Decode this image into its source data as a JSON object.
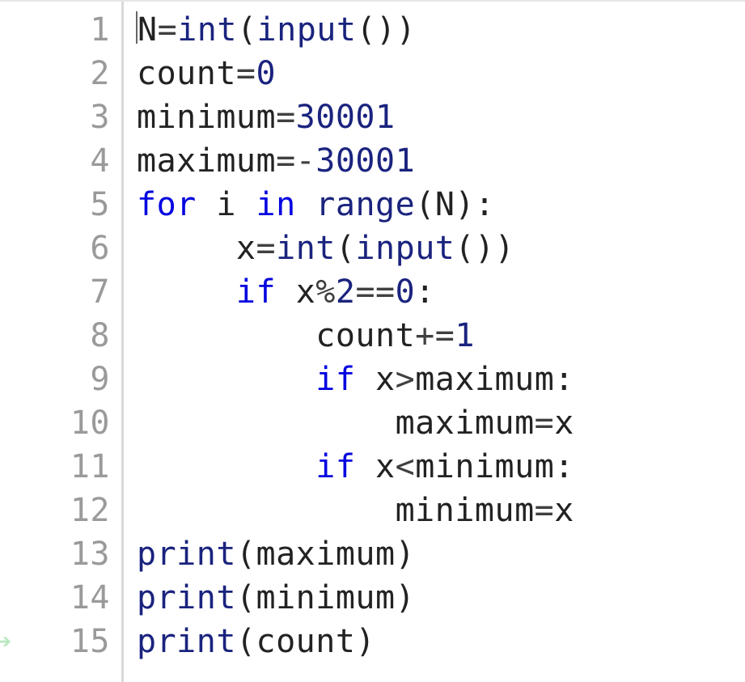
{
  "editor": {
    "cursor_line": 1,
    "cursor_col": 0,
    "active_line_arrow": 15,
    "lines": [
      {
        "n": 1,
        "tokens": [
          {
            "t": "N",
            "c": "id"
          },
          {
            "t": "=",
            "c": "op"
          },
          {
            "t": "int",
            "c": "fn"
          },
          {
            "t": "(",
            "c": "punc"
          },
          {
            "t": "input",
            "c": "fn"
          },
          {
            "t": "(",
            "c": "punc"
          },
          {
            "t": ")",
            "c": "punc"
          },
          {
            "t": ")",
            "c": "punc"
          }
        ]
      },
      {
        "n": 2,
        "tokens": [
          {
            "t": "count",
            "c": "id"
          },
          {
            "t": "=",
            "c": "op"
          },
          {
            "t": "0",
            "c": "num"
          }
        ]
      },
      {
        "n": 3,
        "tokens": [
          {
            "t": "minimum",
            "c": "id"
          },
          {
            "t": "=",
            "c": "op"
          },
          {
            "t": "30001",
            "c": "num"
          }
        ]
      },
      {
        "n": 4,
        "tokens": [
          {
            "t": "maximum",
            "c": "id"
          },
          {
            "t": "=",
            "c": "op"
          },
          {
            "t": "-",
            "c": "op"
          },
          {
            "t": "30001",
            "c": "num"
          }
        ]
      },
      {
        "n": 5,
        "tokens": [
          {
            "t": "for",
            "c": "kw"
          },
          {
            "t": " ",
            "c": "id"
          },
          {
            "t": "i",
            "c": "id"
          },
          {
            "t": " ",
            "c": "id"
          },
          {
            "t": "in",
            "c": "kw"
          },
          {
            "t": " ",
            "c": "id"
          },
          {
            "t": "range",
            "c": "fn"
          },
          {
            "t": "(",
            "c": "punc"
          },
          {
            "t": "N",
            "c": "id"
          },
          {
            "t": ")",
            "c": "punc"
          },
          {
            "t": ":",
            "c": "punc"
          }
        ]
      },
      {
        "n": 6,
        "tokens": [
          {
            "t": "     ",
            "c": "id"
          },
          {
            "t": "x",
            "c": "id"
          },
          {
            "t": "=",
            "c": "op"
          },
          {
            "t": "int",
            "c": "fn"
          },
          {
            "t": "(",
            "c": "punc"
          },
          {
            "t": "input",
            "c": "fn"
          },
          {
            "t": "(",
            "c": "punc"
          },
          {
            "t": ")",
            "c": "punc"
          },
          {
            "t": ")",
            "c": "punc"
          }
        ]
      },
      {
        "n": 7,
        "tokens": [
          {
            "t": "     ",
            "c": "id"
          },
          {
            "t": "if",
            "c": "kw"
          },
          {
            "t": " ",
            "c": "id"
          },
          {
            "t": "x",
            "c": "id"
          },
          {
            "t": "%",
            "c": "op"
          },
          {
            "t": "2",
            "c": "num"
          },
          {
            "t": "==",
            "c": "op"
          },
          {
            "t": "0",
            "c": "num"
          },
          {
            "t": ":",
            "c": "punc"
          }
        ]
      },
      {
        "n": 8,
        "tokens": [
          {
            "t": "         ",
            "c": "id"
          },
          {
            "t": "count",
            "c": "id"
          },
          {
            "t": "+=",
            "c": "op"
          },
          {
            "t": "1",
            "c": "num"
          }
        ]
      },
      {
        "n": 9,
        "tokens": [
          {
            "t": "         ",
            "c": "id"
          },
          {
            "t": "if",
            "c": "kw"
          },
          {
            "t": " ",
            "c": "id"
          },
          {
            "t": "x",
            "c": "id"
          },
          {
            "t": ">",
            "c": "op"
          },
          {
            "t": "maximum",
            "c": "id"
          },
          {
            "t": ":",
            "c": "punc"
          }
        ]
      },
      {
        "n": 10,
        "tokens": [
          {
            "t": "             ",
            "c": "id"
          },
          {
            "t": "maximum",
            "c": "id"
          },
          {
            "t": "=",
            "c": "op"
          },
          {
            "t": "x",
            "c": "id"
          }
        ]
      },
      {
        "n": 11,
        "tokens": [
          {
            "t": "         ",
            "c": "id"
          },
          {
            "t": "if",
            "c": "kw"
          },
          {
            "t": " ",
            "c": "id"
          },
          {
            "t": "x",
            "c": "id"
          },
          {
            "t": "<",
            "c": "op"
          },
          {
            "t": "minimum",
            "c": "id"
          },
          {
            "t": ":",
            "c": "punc"
          }
        ]
      },
      {
        "n": 12,
        "tokens": [
          {
            "t": "             ",
            "c": "id"
          },
          {
            "t": "minimum",
            "c": "id"
          },
          {
            "t": "=",
            "c": "op"
          },
          {
            "t": "x",
            "c": "id"
          }
        ]
      },
      {
        "n": 13,
        "tokens": [
          {
            "t": "print",
            "c": "fn"
          },
          {
            "t": "(",
            "c": "punc"
          },
          {
            "t": "maximum",
            "c": "id"
          },
          {
            "t": ")",
            "c": "punc"
          }
        ]
      },
      {
        "n": 14,
        "tokens": [
          {
            "t": "print",
            "c": "fn"
          },
          {
            "t": "(",
            "c": "punc"
          },
          {
            "t": "minimum",
            "c": "id"
          },
          {
            "t": ")",
            "c": "punc"
          }
        ]
      },
      {
        "n": 15,
        "tokens": [
          {
            "t": "print",
            "c": "fn"
          },
          {
            "t": "(",
            "c": "punc"
          },
          {
            "t": "count",
            "c": "id"
          },
          {
            "t": ")",
            "c": "punc"
          }
        ]
      }
    ]
  }
}
